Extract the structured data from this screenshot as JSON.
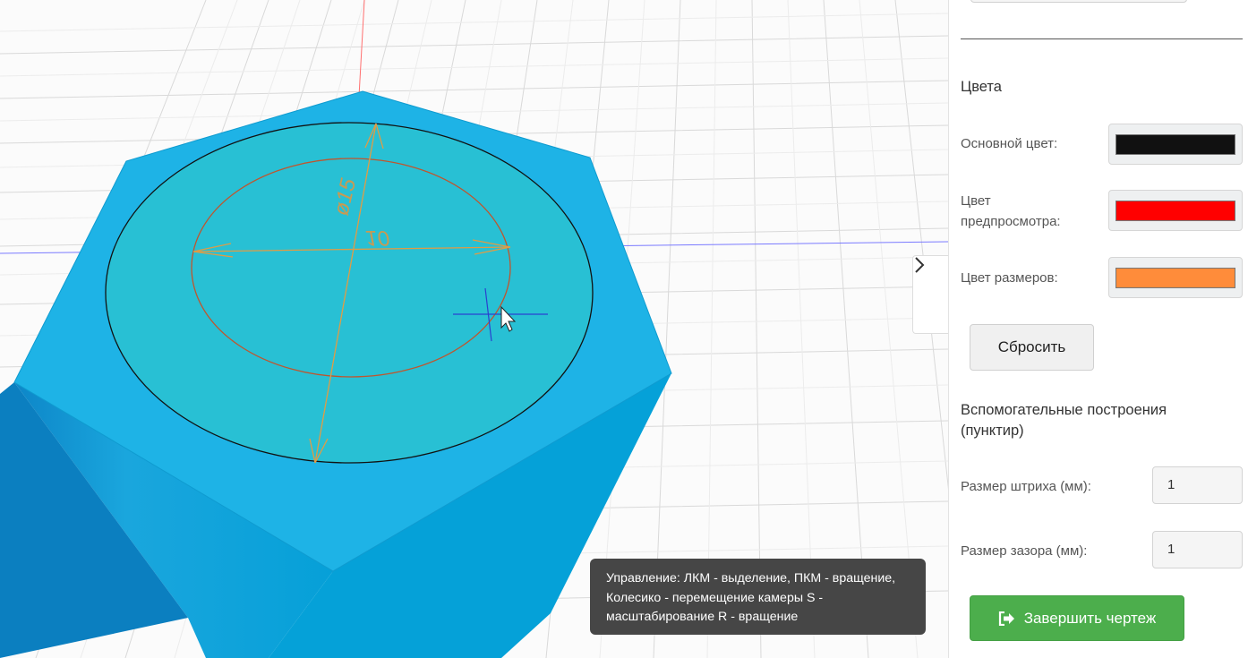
{
  "viewport": {
    "dimension_diameter": "ø15",
    "dimension_width": "10",
    "colors": {
      "body": "#1fb0e4",
      "top_face": "#27c1d6",
      "grid": "#d7d7d7",
      "sketch_circle": "#c85a2a",
      "dimension": "#e0a048",
      "axis_x": "#6666ff",
      "axis_y": "#ff6666"
    },
    "tooltip": {
      "text": "Управление: ЛКМ - выделение, ПКМ - вращение, Колесико - перемещение камеры S - масштабирование R - вращение"
    }
  },
  "sidebar": {
    "colors_heading": "Цвета",
    "main_color": {
      "label": "Основной цвет:",
      "value": "#111111"
    },
    "preview_color": {
      "label_line1": "Цвет",
      "label_line2": "предпросмотра:",
      "value": "#ff0000"
    },
    "dimension_color": {
      "label": "Цвет размеров:",
      "value": "#ff8c3a"
    },
    "reset_label": "Сбросить",
    "aux_heading_line1": "Вспомогательные построения",
    "aux_heading_line2": "(пунктир)",
    "stroke_size": {
      "label": "Размер штриха (мм):",
      "value": "1"
    },
    "gap_size": {
      "label": "Размер зазора (мм):",
      "value": "1"
    },
    "finish_label": "Завершить чертеж"
  }
}
